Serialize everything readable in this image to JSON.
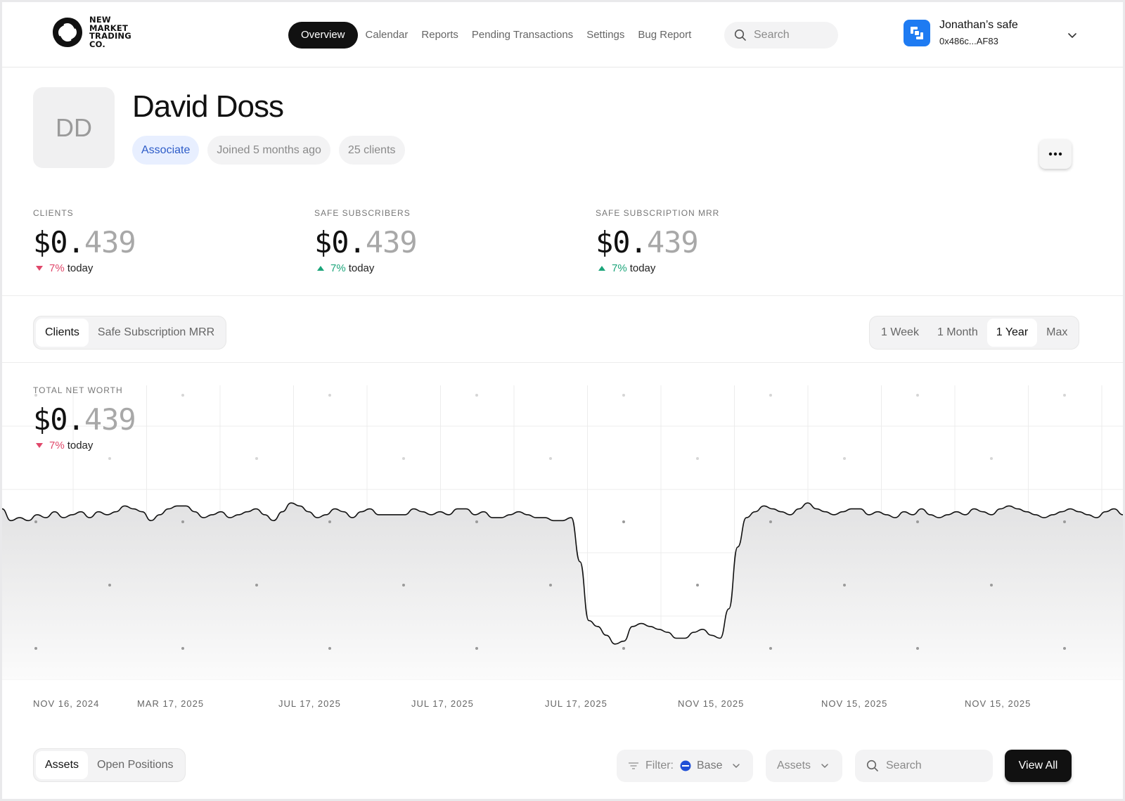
{
  "header": {
    "logo_lines": [
      "NEW",
      "MARKET",
      "TRADING",
      "CO."
    ],
    "nav": [
      {
        "label": "Overview",
        "active": true
      },
      {
        "label": "Calendar",
        "active": false
      },
      {
        "label": "Reports",
        "active": false
      },
      {
        "label": "Pending Transactions",
        "active": false
      },
      {
        "label": "Settings",
        "active": false
      },
      {
        "label": "Bug Report",
        "active": false
      }
    ],
    "search_placeholder": "Search",
    "safe": {
      "name": "Jonathan’s safe",
      "address": "0x486c...AF83",
      "icon": "safe-logo-icon",
      "icon_color": "#1e7bf2"
    }
  },
  "profile": {
    "initials": "DD",
    "name": "David Doss",
    "role": "Associate",
    "joined": "Joined 5 months ago",
    "clients": "25 clients"
  },
  "stats": [
    {
      "label": "CLIENTS",
      "int": "$0.",
      "frac": "439",
      "pct": "7%",
      "dir": "down",
      "suffix": "today"
    },
    {
      "label": "SAFE SUBSCRIBERS",
      "int": "$0.",
      "frac": "439",
      "pct": "7%",
      "dir": "up",
      "suffix": "today"
    },
    {
      "label": "SAFE SUBSCRIPTION MRR",
      "int": "$0.",
      "frac": "439",
      "pct": "7%",
      "dir": "up",
      "suffix": "today"
    }
  ],
  "metric_tabs": [
    {
      "label": "Clients",
      "active": true
    },
    {
      "label": "Safe Subscription MRR",
      "active": false
    }
  ],
  "range_tabs": [
    {
      "label": "1 Week",
      "active": false
    },
    {
      "label": "1 Month",
      "active": false
    },
    {
      "label": "1 Year",
      "active": true
    },
    {
      "label": "Max",
      "active": false
    }
  ],
  "chart_title": {
    "label": "TOTAL NET WORTH",
    "int": "$0.",
    "frac": "439",
    "pct": "7%",
    "dir": "down",
    "suffix": "today"
  },
  "chart_data": {
    "type": "area",
    "title": "",
    "xlabel": "",
    "ylabel": "",
    "x_tick_labels": [
      "NOV 16, 2024",
      "MAR 17, 2025",
      "JUL 17, 2025",
      "JUL 17, 2025",
      "JUL 17, 2025",
      "NOV 15, 2025",
      "NOV 15, 2025",
      "NOV 15, 2025"
    ],
    "ylim": [
      0,
      100
    ],
    "grid": true,
    "line_color": "#111111",
    "fill_color": "#e6e6e6",
    "values": [
      58,
      54,
      55,
      54,
      56,
      55,
      57,
      55,
      56,
      57,
      55,
      57,
      56,
      57,
      59,
      58,
      57,
      54,
      56,
      58,
      59,
      59,
      57,
      55,
      56,
      57,
      55,
      56,
      57,
      58,
      56,
      54,
      57,
      60,
      59,
      57,
      55,
      56,
      58,
      57,
      55,
      57,
      58,
      56,
      56,
      56,
      56,
      58,
      57,
      56,
      57,
      56,
      58,
      58,
      56,
      57,
      55,
      55,
      56,
      57,
      56,
      55,
      55,
      54,
      54,
      55,
      40,
      20,
      18,
      15,
      12,
      13,
      18,
      19,
      18,
      17,
      16,
      14,
      14,
      16,
      17,
      15,
      14,
      24,
      45,
      55,
      57,
      59,
      58,
      57,
      56,
      58,
      60,
      58,
      57,
      56,
      57,
      58,
      58,
      56,
      57,
      56,
      55,
      57,
      56,
      58,
      56,
      55,
      56,
      57,
      56,
      58,
      57,
      56,
      58,
      59,
      58,
      57,
      56,
      55,
      56,
      57,
      58,
      57,
      56,
      55,
      57,
      58,
      56
    ]
  },
  "bottom": {
    "tabs": [
      {
        "label": "Assets",
        "active": true
      },
      {
        "label": "Open Positions",
        "active": false
      }
    ],
    "filter_label": "Filter:",
    "filter_value": "Base",
    "assets_select": "Assets",
    "search_placeholder": "Search",
    "view_all": "View All"
  }
}
